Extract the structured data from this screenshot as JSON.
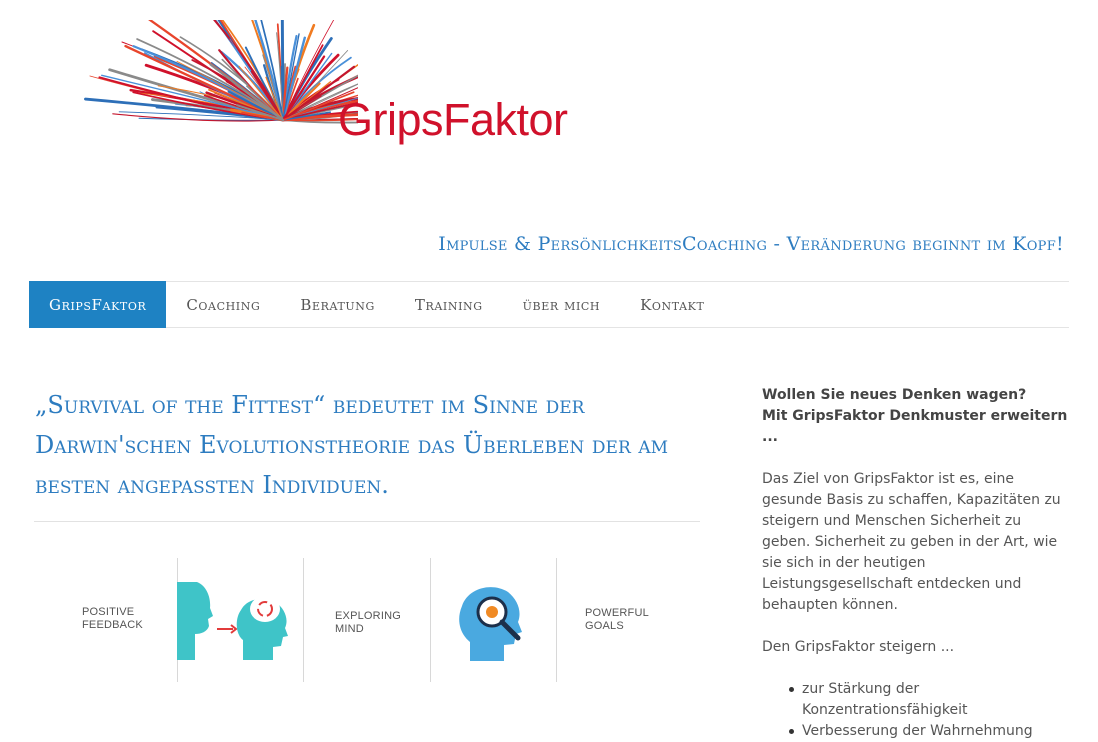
{
  "logo": {
    "text": "GripsFaktor"
  },
  "tagline": "Impulse & PersönlichkeitsCoaching - Veränderung beginnt im Kopf!",
  "nav": {
    "items": [
      {
        "label": "GripsFaktor",
        "active": true
      },
      {
        "label": "Coaching"
      },
      {
        "label": "Beratung"
      },
      {
        "label": "Training"
      },
      {
        "label": "über mich"
      },
      {
        "label": "Kontakt"
      }
    ]
  },
  "main": {
    "headline": "„Survival of the Fittest“ bedeutet im Sinne der Darwin'schen Evolutionstheorie das Überleben der am besten angepassten Individuen.",
    "infographic": {
      "labels": [
        "Positive feedback",
        "Exploring mind",
        "Powerful goals"
      ]
    }
  },
  "sidebar": {
    "intro_line1": "Wollen Sie neues Denken wagen?",
    "intro_line2": "Mit GripsFaktor Denkmuster erweitern ...",
    "paragraph": "Das Ziel von GripsFaktor ist es, eine gesunde Basis zu schaffen, Kapazitäten zu steigern und Menschen Sicherheit zu geben. Sicherheit zu geben in der Art, wie sie sich in der heutigen Leistungsgesellschaft entdecken und behaupten können.",
    "lead": "Den GripsFaktor steigern ...",
    "bullets": [
      "zur Stärkung der Konzentrationsfähigkeit",
      "Verbesserung der Wahrnehmung"
    ]
  },
  "colors": {
    "brand_red": "#d0112b",
    "accent_blue": "#1e82c3",
    "heading_blue": "#2d7cc0"
  }
}
